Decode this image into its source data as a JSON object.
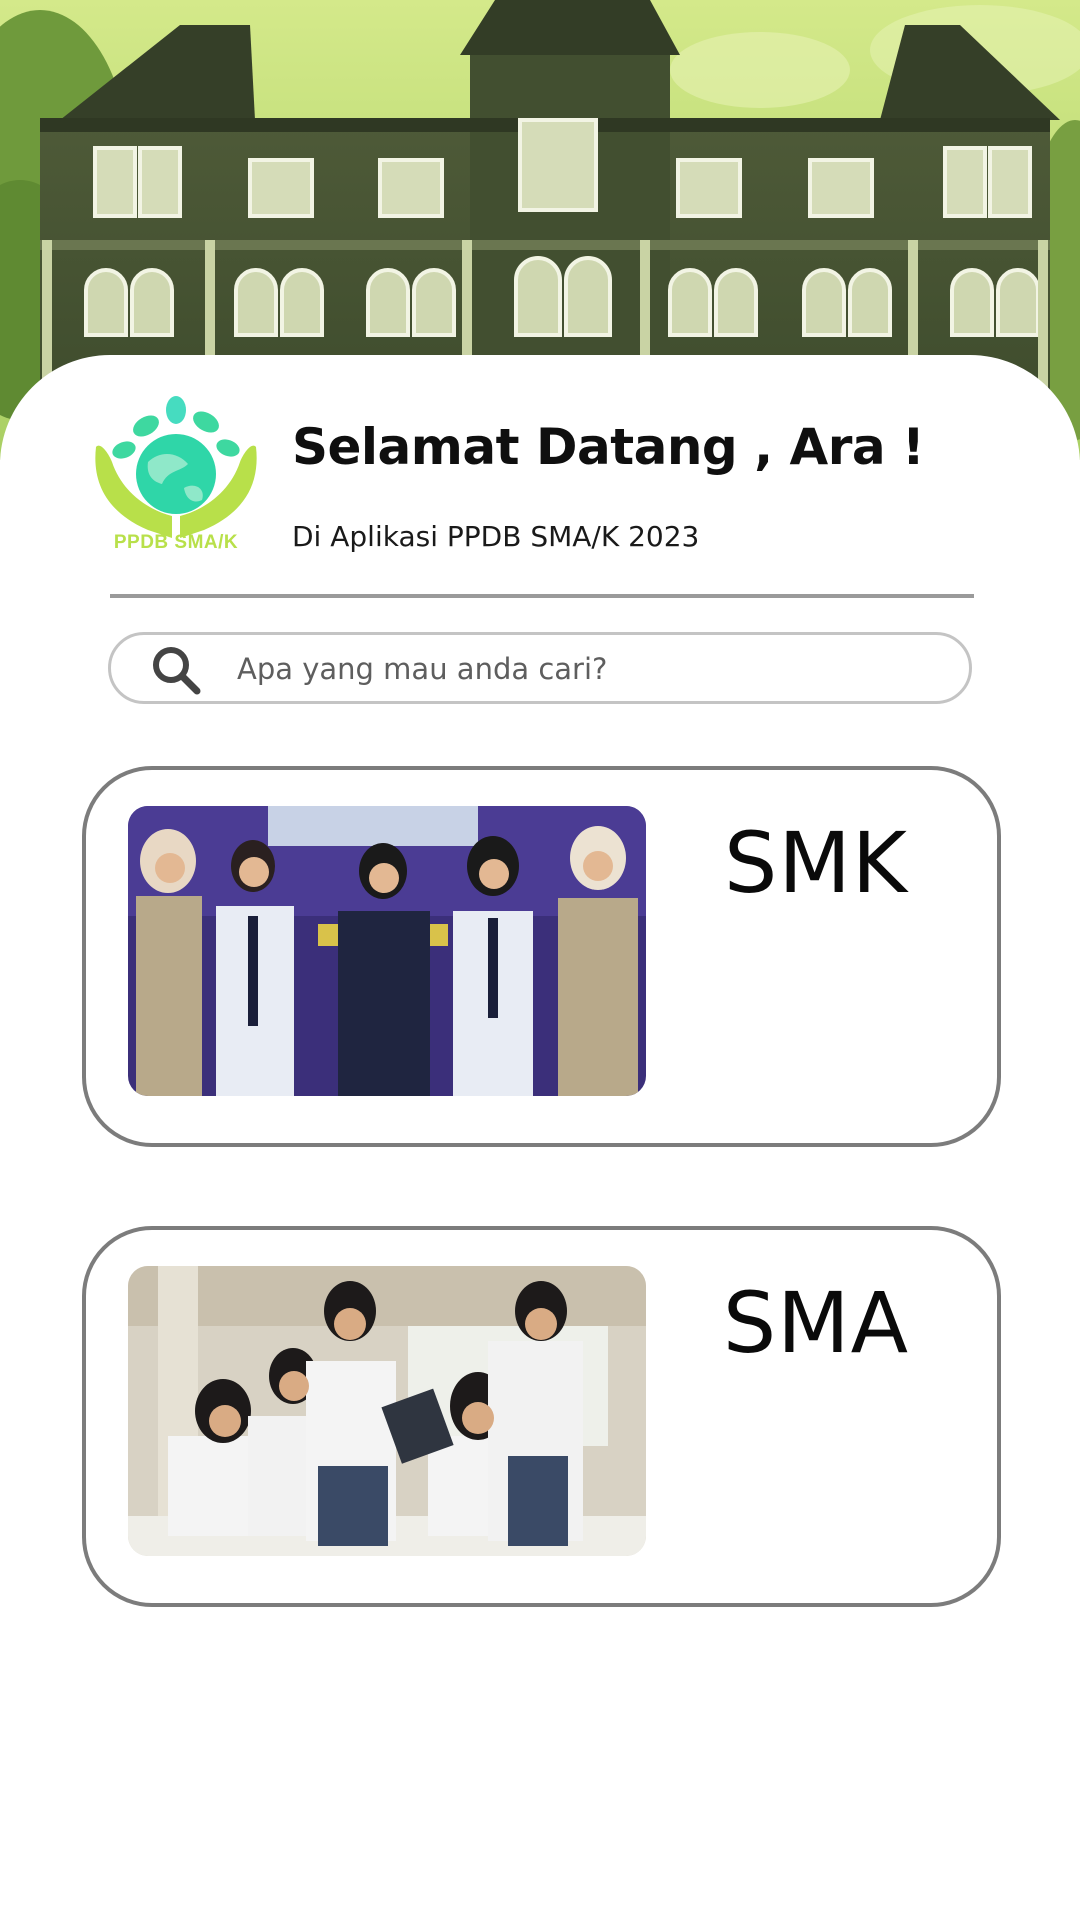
{
  "header": {
    "welcome_title": "Selamat Datang , Ara !",
    "subtitle": "Di Aplikasi PPDB SMA/K 2023",
    "logo_caption": "PPDB SMA/K"
  },
  "search": {
    "placeholder": "Apa yang mau anda cari?",
    "icon": "search-icon"
  },
  "categories": [
    {
      "label": "SMK",
      "photo": "students-in-uniform-photo"
    },
    {
      "label": "SMA",
      "photo": "students-studying-photo"
    }
  ],
  "colors": {
    "hero_green": "#9cc85a",
    "logo_green": "#b8e04a",
    "logo_teal": "#2fd6a8",
    "card_border": "#7c7c7c",
    "divider": "#9a9a9a"
  }
}
